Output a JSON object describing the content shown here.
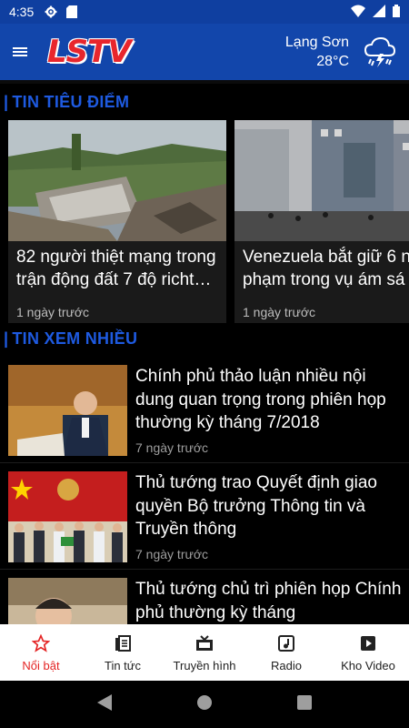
{
  "status": {
    "time": "4:35"
  },
  "header": {
    "logo": "LSTV",
    "city": "Lạng Sơn",
    "temperature": "28°C",
    "weather_icon": "rain-cloud-icon"
  },
  "sections": {
    "highlight": {
      "title": "TIN TIÊU ĐIỂM"
    },
    "most_viewed": {
      "title": "TIN XEM NHIỀU"
    }
  },
  "featured": [
    {
      "title_line1": "82 người thiệt mạng trong",
      "title_line2": "trận động đất 7 độ richt…",
      "time": "1 ngày trước"
    },
    {
      "title_line1": "Venezuela bắt giữ 6 n",
      "title_line2": "phạm trong vụ ám sá",
      "time": "1 ngày trước"
    }
  ],
  "articles": [
    {
      "title": "Chính phủ thảo luận nhiều nội dung quan trọng trong phiên họp thường kỳ tháng 7/2018",
      "time": "7 ngày trước"
    },
    {
      "title": "Thủ tướng trao Quyết định giao quyền Bộ trưởng Thông tin và Truyền thông",
      "time": "7 ngày trước"
    },
    {
      "title": "Thủ tướng chủ trì phiên họp Chính phủ thường kỳ tháng",
      "time": ""
    }
  ],
  "nav": {
    "featured": "Nổi bật",
    "news": "Tin tức",
    "tv": "Truyền hình",
    "radio": "Radio",
    "video": "Kho Video"
  },
  "colors": {
    "appbar": "#1246ab",
    "accent": "#1e5ae0",
    "active": "#e42424"
  }
}
